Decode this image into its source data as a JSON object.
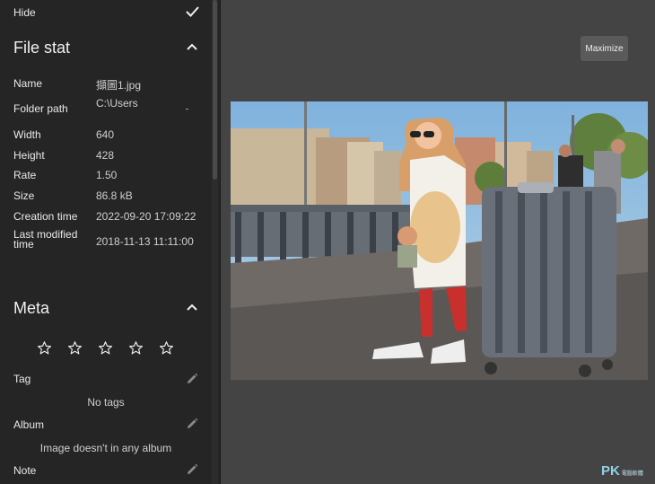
{
  "sidebar": {
    "hide_label": "Hide",
    "file_stat": {
      "title": "File stat",
      "rows": [
        {
          "label": "Name",
          "value": "擷圖1.jpg"
        },
        {
          "label": "Folder path",
          "value": "C:\\Users"
        },
        {
          "label": "Width",
          "value": "640"
        },
        {
          "label": "Height",
          "value": "428"
        },
        {
          "label": "Rate",
          "value": "1.50"
        },
        {
          "label": "Size",
          "value": "86.8 kB"
        },
        {
          "label": "Creation time",
          "value": "2022-09-20 17:09:22"
        },
        {
          "label": "Last modified time",
          "value": "2018-11-13 11:11:00"
        }
      ]
    },
    "meta": {
      "title": "Meta",
      "rating": 0,
      "tag_label": "Tag",
      "tag_empty": "No tags",
      "album_label": "Album",
      "album_empty": "Image doesn't in any album",
      "note_label": "Note"
    }
  },
  "main": {
    "maximize_label": "Maximize",
    "watermark": "PK",
    "watermark_sub": "電腦軟體"
  },
  "colors": {
    "sidebar_bg": "#252525",
    "main_bg": "#444444",
    "text": "#e9e9e9"
  }
}
